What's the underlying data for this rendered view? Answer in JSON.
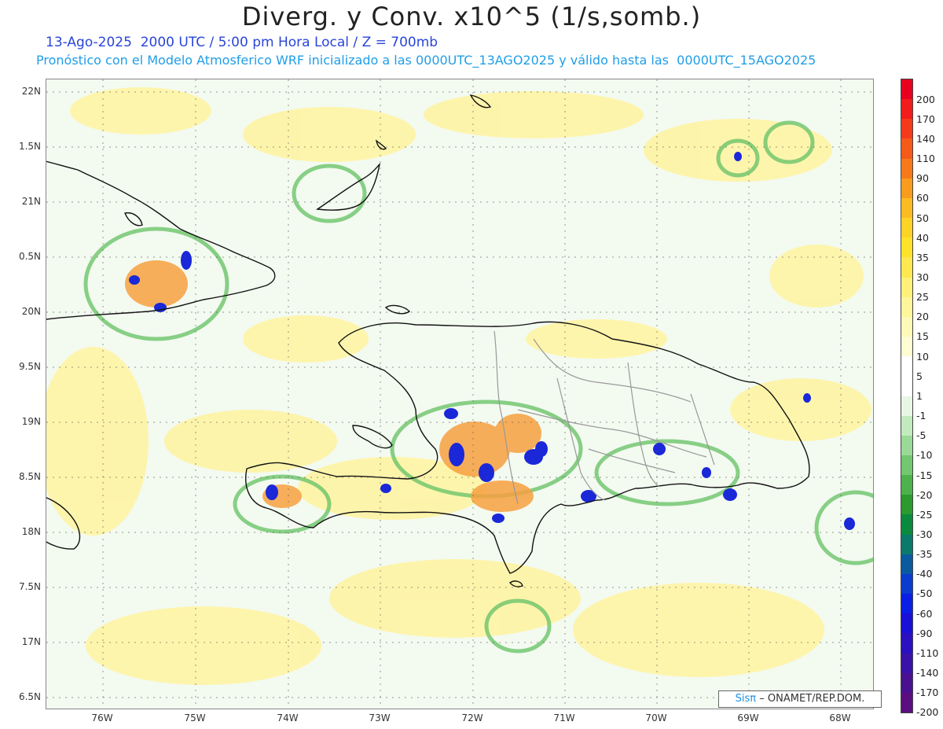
{
  "header": {
    "title": "Diverg. y Conv. x10^5 (1/s,somb.)",
    "line1": "13-Ago-2025  2000 UTC / 5:00 pm Hora Local / Z = 700mb",
    "line2": "Pronóstico con el Modelo Atmosferico WRF inicializado a las 0000UTC_13AGO2025 y válido hasta las  0000UTC_15AGO2025"
  },
  "map": {
    "lat_labels": [
      "22N",
      "1.5N",
      "21N",
      "0.5N",
      "20N",
      "9.5N",
      "19N",
      "8.5N",
      "18N",
      "7.5N",
      "17N",
      "6.5N"
    ],
    "lon_labels": [
      "76W",
      "75W",
      "74W",
      "73W",
      "72W",
      "71W",
      "70W",
      "69W",
      "68W"
    ]
  },
  "colorbar": {
    "labels": [
      "200",
      "170",
      "140",
      "110",
      "90",
      "60",
      "50",
      "40",
      "35",
      "30",
      "25",
      "20",
      "15",
      "10",
      "5",
      "1",
      "-1",
      "-5",
      "-10",
      "-15",
      "-20",
      "-25",
      "-30",
      "-35",
      "-40",
      "-50",
      "-60",
      "-90",
      "-110",
      "-140",
      "-170",
      "-200"
    ],
    "colors": [
      "#e8001e",
      "#f21c1c",
      "#f53a1a",
      "#f55a18",
      "#f77a1a",
      "#f99c1e",
      "#fbbc22",
      "#fdd426",
      "#ffe22a",
      "#ffe850",
      "#fff07a",
      "#fff59a",
      "#fff9b8",
      "#fffbd2",
      "#ffffff",
      "#ffffff",
      "#e8f6e4",
      "#c2ebbd",
      "#9ad997",
      "#72c770",
      "#4db14c",
      "#2a9a2e",
      "#0a8a3c",
      "#0a7a6a",
      "#0a5aa0",
      "#0a3cd0",
      "#0a1ee6",
      "#1a10d8",
      "#2a10c0",
      "#3a12a8",
      "#4a1090",
      "#5a0e80"
    ]
  },
  "credit": {
    "sis": "Sisπ",
    "rest": "– ONAMET/REP.DOM."
  }
}
